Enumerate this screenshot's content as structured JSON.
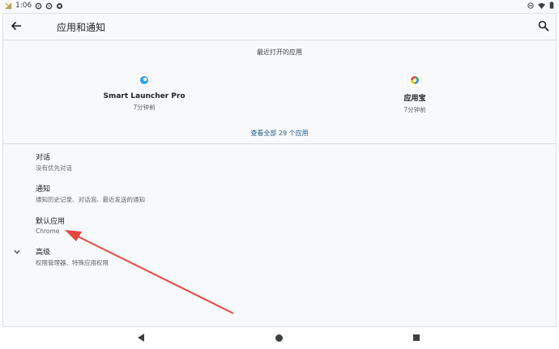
{
  "status_bar": {
    "time": "1:06"
  },
  "app_bar": {
    "title": "应用和通知"
  },
  "recent": {
    "heading": "最近打开的应用",
    "apps": [
      {
        "name": "Smart Launcher Pro",
        "time": "7分钟前",
        "icon": "smart-launcher-icon"
      },
      {
        "name": "应用宝",
        "time": "7分钟前",
        "icon": "app-store-icon"
      }
    ],
    "see_all": "查看全部 29 个应用"
  },
  "settings": [
    {
      "title": "对话",
      "subtitle": "没有优先对话"
    },
    {
      "title": "通知",
      "subtitle": "通知历史记录、对话泡、最近发送的通知"
    },
    {
      "title": "默认应用",
      "subtitle": "Chrome"
    },
    {
      "title": "高级",
      "subtitle": "权限管理器、特殊应用权限"
    }
  ],
  "annotation": {
    "arrow_color": "#e8453c"
  }
}
